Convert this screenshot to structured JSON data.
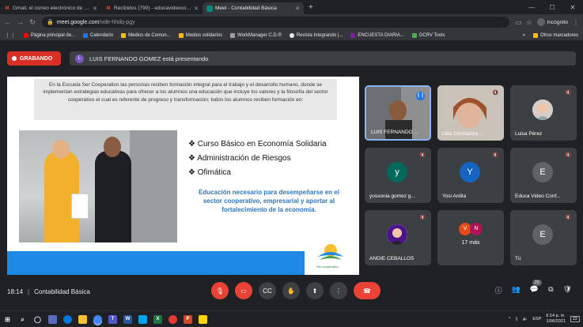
{
  "browser": {
    "tabs": [
      {
        "title": "Gmail, el correo electrónico de G...",
        "icon": "gmail-icon",
        "active": false
      },
      {
        "title": "Recibidos (790) - educavideocor...",
        "icon": "gmail-icon",
        "active": false
      },
      {
        "title": "Meet - Contabilidad Básica",
        "icon": "meet-icon",
        "active": true
      }
    ],
    "new_tab": "+",
    "url_host": "meet.google.com",
    "url_path": "/ode-hhdq-pgy",
    "profile": "Incógnito",
    "bookmarks": [
      {
        "label": "Página principal de...",
        "icon": "youtube-icon"
      },
      {
        "label": "Calendario",
        "icon": "calendar-icon"
      },
      {
        "label": "Medios de Comun...",
        "icon": "folder-icon"
      },
      {
        "label": "Medios solidarios",
        "icon": "folder-icon"
      },
      {
        "label": "WorkManager C.D.®",
        "icon": "workmanager-icon"
      },
      {
        "label": "Revista Integrando |...",
        "icon": "bookmark-icon"
      },
      {
        "label": "ENCUESTA DIARIA...",
        "icon": "form-icon"
      },
      {
        "label": "DCRV Tools",
        "icon": "tools-icon"
      }
    ],
    "bookmarks_more": "»",
    "other_bookmarks": "Otros marcadores"
  },
  "meet": {
    "recording_label": "GRABANDO",
    "presenter_initial": "L",
    "presenting_text": "LUIS FERNANDO GOMEZ está presentando",
    "meeting_time": "18:14",
    "meeting_name": "Contabilidad Básica",
    "participant_count": "26"
  },
  "slide": {
    "intro": "En la Escuela Ser Cooperativo las personas reciben formación integral para el trabajo y el desarrollo humano, donde se implementan estrategias educativas para ofrecer a los alumnos una educación que incluye los valores y la filosofía del sector cooperativo el cual es referente de progreso y transformación; todos los alumnos reciben formación en:",
    "bullets": [
      "Curso Básico en  Economía Solidaria",
      "Administración de Riesgos",
      "Ofimática"
    ],
    "mission": "Educación necesario para desempeñarse en el sector cooperativo, empresarial y aportar al fortalecimiento de la economía.",
    "logo_text": "Ser cooperativo"
  },
  "participants": [
    {
      "name": "LUIS FERNANDO ...",
      "type": "video",
      "speaking": true
    },
    {
      "name": "Lida Constanza ...",
      "type": "video"
    },
    {
      "name": "Luisa Pérez",
      "type": "photo"
    },
    {
      "name": "yossonia gomez g...",
      "initial": "y",
      "color": "#00695c"
    },
    {
      "name": "Yosi Ardila",
      "initial": "Y",
      "color": "#1565c0"
    },
    {
      "name": "Educa Video Conf...",
      "initial": "E",
      "color": "#5f6368"
    },
    {
      "name": "ANGIE CEBALLOS",
      "type": "photo"
    },
    {
      "more": "17 más",
      "initials": [
        "V",
        "N"
      ]
    },
    {
      "name": "Tú",
      "initial": "E",
      "color": "#5f6368"
    }
  ],
  "taskbar": {
    "time": "6:14 p. m.",
    "date": "1/06/2021",
    "lang": "ESP",
    "notif": "22"
  },
  "colors": {
    "accent": "#1a73e8",
    "danger": "#ea4335",
    "slide_blue": "#1e88e5"
  }
}
